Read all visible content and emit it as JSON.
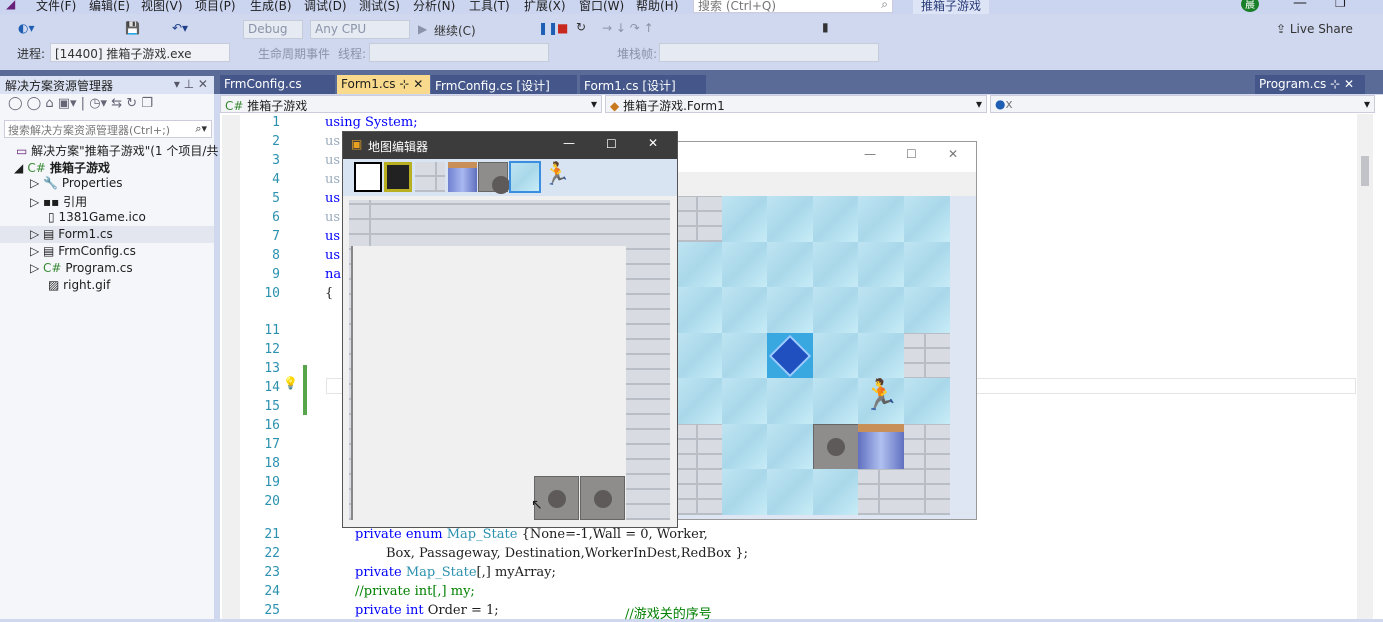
{
  "menu": [
    "文件(F)",
    "编辑(E)",
    "视图(V)",
    "项目(P)",
    "生成(B)",
    "调试(D)",
    "测试(S)",
    "分析(N)",
    "工具(T)",
    "扩展(X)",
    "窗口(W)",
    "帮助(H)"
  ],
  "search": {
    "placeholder": "搜索 (Ctrl+Q)"
  },
  "solution_title": "推箱子游戏",
  "toolbar": {
    "config": "Debug",
    "platform": "Any CPU",
    "continue": "继续(C)",
    "live_share": "Live Share"
  },
  "debugbar": {
    "process_label": "进程:",
    "process": "[14400] 推箱子游戏.exe",
    "lifecycle": "生命周期事件",
    "thread": "线程:",
    "stack": "堆栈帧:"
  },
  "explorer": {
    "title": "解决方案资源管理器",
    "search_placeholder": "搜索解决方案资源管理器(Ctrl+;)",
    "items": [
      "解决方案\"推箱子游戏\"(1 个项目/共 1",
      "推箱子游戏",
      "Properties",
      "引用",
      "1381Game.ico",
      "Form1.cs",
      "FrmConfig.cs",
      "Program.cs",
      "right.gif"
    ]
  },
  "tabs": [
    "FrmConfig.cs",
    "Form1.cs",
    "FrmConfig.cs [设计]",
    "Form1.cs [设计]",
    "Program.cs"
  ],
  "nav": {
    "project": "推箱子游戏",
    "class": "推箱子游戏.Form1",
    "member": "x"
  },
  "lines": [
    "1",
    "2",
    "3",
    "4",
    "5",
    "6",
    "7",
    "8",
    "9",
    "10",
    "11",
    "12",
    "13",
    "14",
    "15",
    "16",
    "17",
    "18",
    "19",
    "20",
    "21",
    "22",
    "23",
    "24",
    "25"
  ],
  "code": {
    "l1": "using System;",
    "us": "us",
    "na": "na",
    "brace": "{",
    "l21a": "private enum ",
    "l21b": "Map_State",
    "l21c": " {None=-1,Wall = 0, Worker,",
    "l22": "Box, Passageway, Destination,WorkerInDest,RedBox };",
    "l23a": "private ",
    "l23b": "Map_State",
    "l23c": "[,] myArray;",
    "l24": "//private int[,] my;",
    "l25a": "private int ",
    "l25b": "Order = 1;",
    "l25c": "//游戏关的序号"
  },
  "editor_window": {
    "title": "地图编辑器"
  },
  "user_initial": "晨"
}
